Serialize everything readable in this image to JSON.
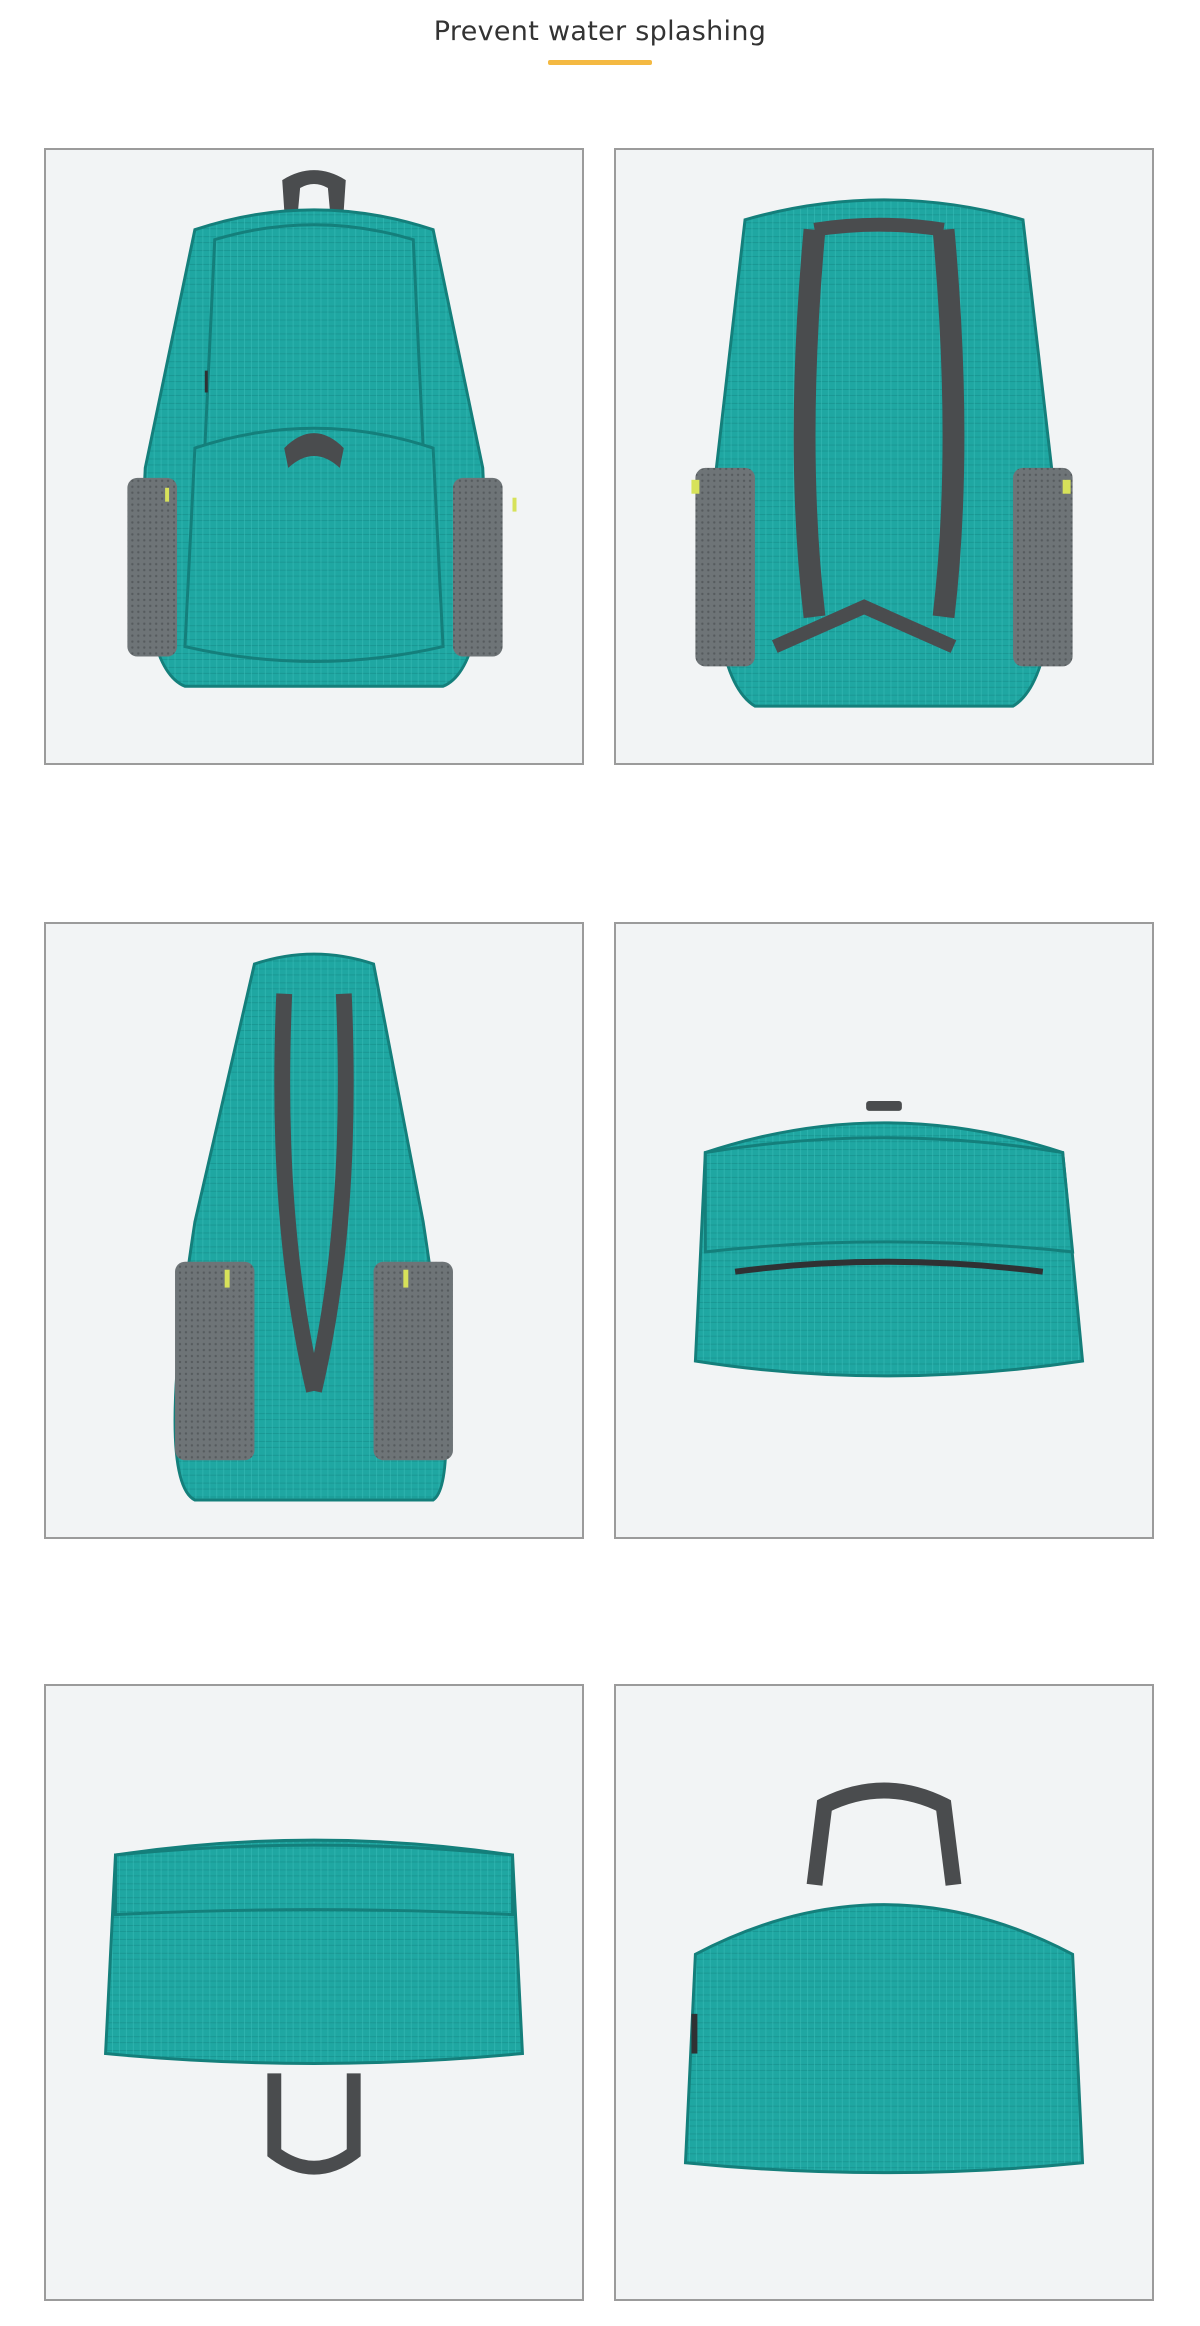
{
  "header": {
    "title": "Prevent water splashing",
    "underline_color": "#f4b942"
  },
  "colors": {
    "teal": "#1fa7a2",
    "teal_dark": "#147f7b",
    "strap_gray": "#4a4c4e",
    "mesh_gray": "#6e7477",
    "zip_yellow": "#d7e25a",
    "photo_bg": "#f2f4f5",
    "frame": "#9b9b9b"
  },
  "photos": [
    {
      "view": "front"
    },
    {
      "view": "back-straps"
    },
    {
      "view": "side-compressed"
    },
    {
      "view": "folded-top"
    },
    {
      "view": "folded-pouch-handle-down"
    },
    {
      "view": "folded-pouch-handle-up"
    }
  ]
}
